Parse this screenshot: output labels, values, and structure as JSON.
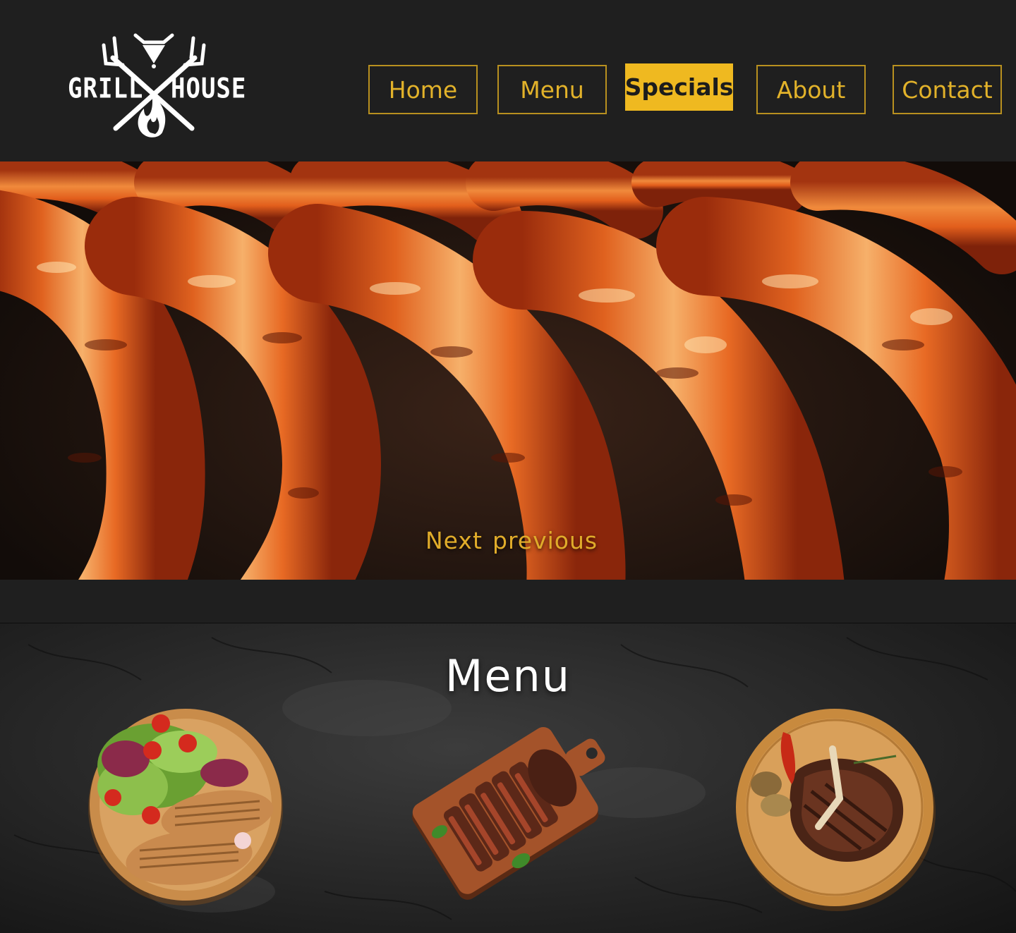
{
  "brand": {
    "word_left": "GRILL",
    "word_right": "HOUSE",
    "icon": "crossed-forks-flame-icon"
  },
  "nav": {
    "items": [
      {
        "label": "Home",
        "active": false
      },
      {
        "label": "Menu",
        "active": false
      },
      {
        "label": "Specials",
        "active": true
      },
      {
        "label": "About",
        "active": false
      },
      {
        "label": "Contact",
        "active": false
      }
    ]
  },
  "hero": {
    "next_label": "Next",
    "previous_label": "previous"
  },
  "menu_section": {
    "title": "Menu"
  },
  "colors": {
    "accent": "#efb920",
    "nav_text": "#e2b22a",
    "header_bg": "#1f1f1f"
  }
}
